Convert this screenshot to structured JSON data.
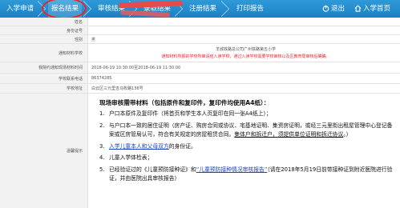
{
  "nav": {
    "steps": [
      "入学申请",
      "报名结果",
      "审核结果",
      "录取结果",
      "注册结果",
      "打印报告"
    ],
    "exit_label": "退出",
    "home_label": "入学首页"
  },
  "info": {
    "name_label": "姓名",
    "id_label": "身份证号",
    "gender_label": "性别",
    "gender_value": "男",
    "school_label": "通知材料学校",
    "school_value": "羊城铁路总公司广州铁路第五小学",
    "school_note": "通知材料所报的学校所审请结入读学校，通过入读学校需要学校审核以及区教育局审核后确确。",
    "verify_label": "我院约通知现场材料时间",
    "verify_value": "2018-06-19 10:30:00至2018-06-19 11:30:00",
    "phone_label": "学校联系电话",
    "phone_value": "86374285",
    "addr_label": "学校地址",
    "addr_value": "白云区三元里吉马牧路136号"
  },
  "notes": {
    "label": "温馨提示",
    "title": "现场审核需带材料（包括原件和复印件，复印件均使用A4纸）：",
    "items": [
      {
        "num": "1.",
        "text": "户口本原件及复印件（将首页和学生本人页复印在同一张A4纸上）；"
      },
      {
        "num": "2.",
        "pre": "与户口本一致的居住证明（房产证、购房合同或协议、宅基地证明、集资房证明，或经三元里街出租屋管理中心登记备案或区房管局认可，符合有关规定的房屋租赁合同。",
        "u1": "集体户和拆迁户，",
        "u2": "须提供单位证明和拆迁协议",
        "post": "。）"
      },
      {
        "num": "3.",
        "u1": "入学儿童本人和父母双方",
        "post": "的身份证。"
      },
      {
        "num": "4.",
        "text": "儿童入学体检表；"
      },
      {
        "num": "5.",
        "pre": "已经验证过的《儿童预防接种证》和",
        "u1": "“儿童预防接种情况审核报告”",
        "post": "（请在2018年5月19日前带接种证到附近医院进行验证，并由医院出具审核报告）"
      }
    ]
  }
}
